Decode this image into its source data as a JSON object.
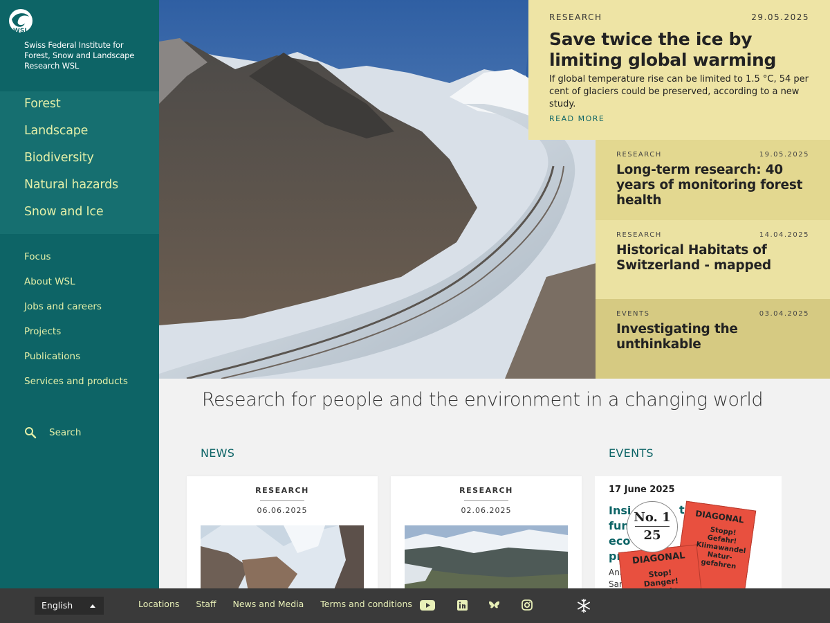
{
  "brand": {
    "logo_text": "WSL",
    "org_name": "Swiss Federal Institute for Forest, Snow and Landscape Research WSL"
  },
  "main_nav": [
    "Forest",
    "Landscape",
    "Biodiversity",
    "Natural hazards",
    "Snow and Ice"
  ],
  "sub_nav": [
    "Focus",
    "About WSL",
    "Jobs and careers",
    "Projects",
    "Publications",
    "Services and products"
  ],
  "search": {
    "label": "Search"
  },
  "featured": {
    "category": "RESEARCH",
    "date": "29.05.2025",
    "title": "Save twice the ice by limiting global warming",
    "text": "If global temperature rise can be limited to 1.5 °C, 54 per cent of glaciers could be preserved, according to a new study.",
    "link": "READ MORE"
  },
  "news_list": [
    {
      "category": "RESEARCH",
      "date": "19.05.2025",
      "title": "Long-term research: 40 years of monitoring forest health"
    },
    {
      "category": "RESEARCH",
      "date": "14.04.2025",
      "title": "Historical Habitats of Switzerland - mapped"
    },
    {
      "category": "EVENTS",
      "date": "03.04.2025",
      "title": "Investigating the unthinkable"
    }
  ],
  "tagline": "Research for people and the environment in a changing world",
  "sections": {
    "news": "NEWS",
    "events": "EVENTS"
  },
  "news_cards": [
    {
      "category": "RESEARCH",
      "date": "06.06.2025"
    },
    {
      "category": "RESEARCH",
      "date": "02.06.2025"
    }
  ],
  "event_card": {
    "date": "17 June 2025",
    "title_fragments": [
      "Insi",
      "fun",
      "eco",
      "pre"
    ],
    "text_fragments": [
      "Ann",
      "San"
    ],
    "text_tail": "s",
    "title_tail": "t"
  },
  "badge": {
    "number": "No. 1",
    "year": "25",
    "back_title": "DIAGONAL",
    "back_text": "Stopp! Gefahr! Klimawandel Natur- gefahren",
    "front_title": "DIAGONAL",
    "front_text": "Stop! Danger! Climate change and natural"
  },
  "footer": {
    "language": "English",
    "links": [
      "Locations",
      "Staff",
      "News and Media",
      "Terms and conditions"
    ],
    "social_icons": [
      "youtube-icon",
      "linkedin-icon",
      "bluesky-icon",
      "instagram-icon",
      "snowflake-icon"
    ]
  },
  "colors": {
    "sidebar": "#0d6466",
    "nav_text": "#e3efa8",
    "feature_bg": "#eee4a5",
    "badge_red": "#e8503f"
  }
}
